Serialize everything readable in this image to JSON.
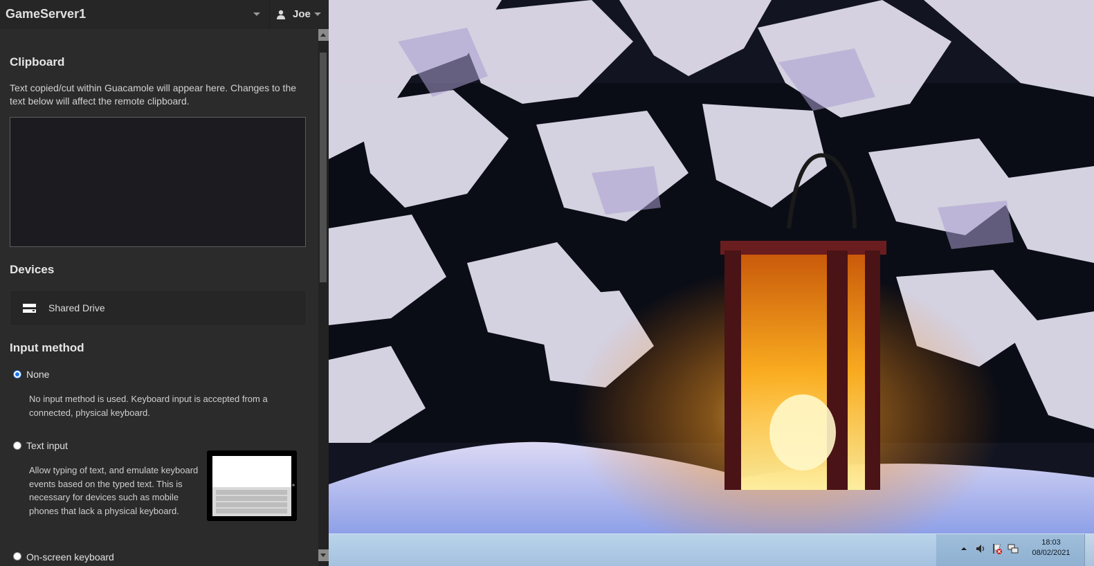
{
  "header": {
    "connection_name": "GameServer1",
    "username": "Joe"
  },
  "clipboard": {
    "title": "Clipboard",
    "description": "Text copied/cut within Guacamole will appear here. Changes to the text below will affect the remote clipboard.",
    "value": ""
  },
  "devices": {
    "title": "Devices",
    "items": [
      {
        "label": "Shared Drive",
        "icon": "drive-icon"
      }
    ]
  },
  "input_method": {
    "title": "Input method",
    "options": [
      {
        "label": "None",
        "selected": true,
        "description": "No input method is used. Keyboard input is accepted from a connected, physical keyboard."
      },
      {
        "label": "Text input",
        "selected": false,
        "description": "Allow typing of text, and emulate keyboard events based on the typed text. This is necessary for devices such as mobile phones that lack a physical keyboard."
      },
      {
        "label": "On-screen keyboard",
        "selected": false
      }
    ]
  },
  "taskbar": {
    "time": "18:03",
    "date": "08/02/2021",
    "tray_icons": [
      "chevron-up-icon",
      "volume-icon",
      "flag-alert-icon",
      "network-icon"
    ]
  },
  "colors": {
    "menu_bg": "#2b2b2b",
    "header_bg": "#262626",
    "taskbar": "#a4c1df",
    "radio_selected": "#1a73e8"
  }
}
